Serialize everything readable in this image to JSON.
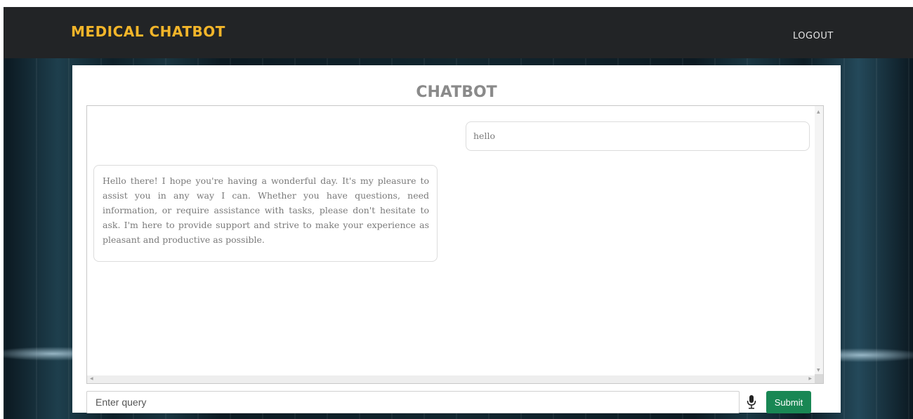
{
  "navbar": {
    "brand": "MEDICAL CHATBOT",
    "logout_label": "LOGOUT"
  },
  "chat": {
    "title": "CHATBOT",
    "messages": [
      {
        "sender": "user",
        "text": "hello"
      },
      {
        "sender": "bot",
        "text": "Hello there! I hope you're having a wonderful day. It's my pleasure to assist you in any way I can. Whether you have questions, need information, or require assistance with tasks, please don't hesitate to ask. I'm here to provide support and strive to make your experience as pleasant and productive as possible."
      }
    ]
  },
  "query": {
    "placeholder": "Enter query",
    "value": "",
    "submit_label": "Submit",
    "mic_icon": "microphone-icon"
  },
  "icons": {
    "scroll_up": "▲",
    "scroll_down": "▼",
    "scroll_left": "◀",
    "scroll_right": "▶"
  },
  "colors": {
    "brand": "#f2b52a",
    "navbar": "#222426",
    "submit": "#198754",
    "title": "#8a8a8a"
  }
}
